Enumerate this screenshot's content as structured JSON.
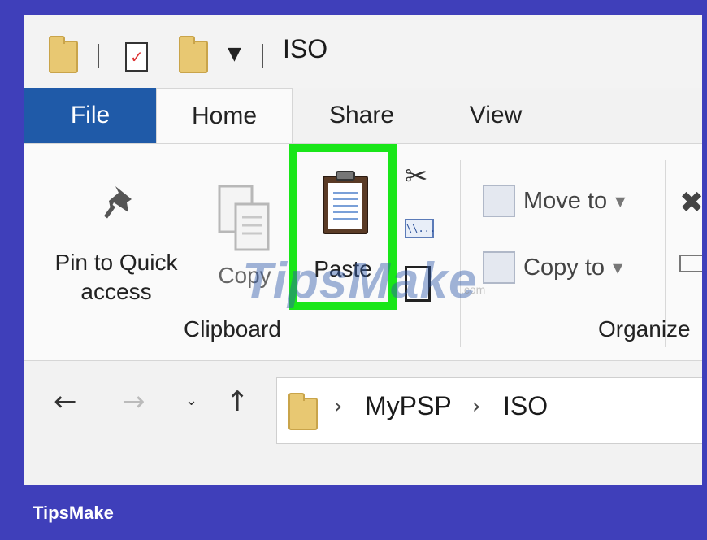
{
  "window": {
    "title": "ISO"
  },
  "tabs": [
    {
      "label": "File"
    },
    {
      "label": "Home"
    },
    {
      "label": "Share"
    },
    {
      "label": "View"
    }
  ],
  "ribbon": {
    "pin_label_line1": "Pin to Quick",
    "pin_label_line2": "access",
    "copy_label": "Copy",
    "paste_label": "Paste",
    "path_icon_text": "\\\\...",
    "clipboard_group": "Clipboard",
    "move_to_label": "Move to",
    "copy_to_label": "Copy to",
    "organize_group": "Organize",
    "highlight_color": "#19e619"
  },
  "navigation": {
    "breadcrumb": [
      "MyPSP",
      "ISO"
    ]
  },
  "watermark": {
    "text": "TipsMake",
    "suffix": ".com"
  },
  "footer": {
    "brand": "TipsMake"
  },
  "colors": {
    "file_tab": "#1f5aa8",
    "background": "#3f3fba"
  },
  "icons": {
    "folder": "folder-icon",
    "properties": "properties-icon",
    "pin": "pin-icon",
    "copy": "copy-icon",
    "paste": "paste-icon",
    "cut": "scissors-icon"
  }
}
